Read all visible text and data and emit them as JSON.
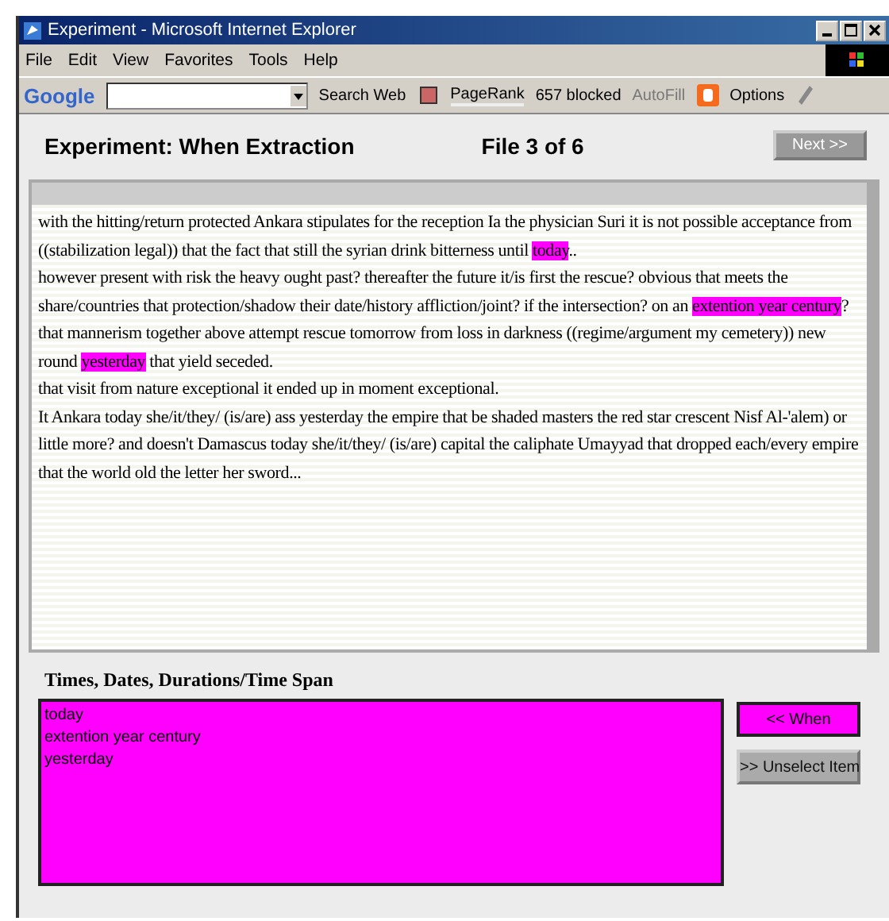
{
  "window": {
    "title": "Experiment - Microsoft Internet Explorer"
  },
  "menu": [
    "File",
    "Edit",
    "View",
    "Favorites",
    "Tools",
    "Help"
  ],
  "toolbar": {
    "logo": "Google",
    "search_button": "Search Web",
    "pagerank": "PageRank",
    "popups": "657 blocked",
    "autofill": {
      "label": "AutoFill",
      "disabled": true
    },
    "options": "Options"
  },
  "header": {
    "title": "Experiment: When Extraction",
    "file": "File 3 of 6",
    "next_button": "Next >>"
  },
  "paragraphs": [
    [
      {
        "text": "with the hitting/return protected Ankara stipulates for the reception Ia the physician Suri it is not possible acceptance from ((stabilization legal)) that the fact that still the syrian drink bitterness until ",
        "highlighted": false
      },
      {
        "text": "today",
        "highlighted": true
      },
      {
        "text": "..",
        "highlighted": false
      }
    ],
    [
      {
        "text": "however present with risk the heavy ought past? thereafter the future it/is first the rescue? obvious that meets the share/countries that protection/shadow their date/history affliction/joint? if the intersection? on an ",
        "highlighted": false
      },
      {
        "text": "extention year century",
        "highlighted": true
      },
      {
        "text": "? that mannerism together above attempt rescue tomorrow from loss in darkness ((regime/argument my cemetery)) new round ",
        "highlighted": false
      },
      {
        "text": "yesterday",
        "highlighted": true
      },
      {
        "text": " that yield seceded.",
        "highlighted": false
      }
    ],
    [
      {
        "text": "that visit from nature exceptional it ended up in moment exceptional.",
        "highlighted": false
      }
    ],
    [
      {
        "text": "It Ankara today she/it/they/ (is/are) ass yesterday the empire that be shaded masters the red star crescent Nisf Al-'alem) or little more? and doesn't Damascus today she/it/they/ (is/are) capital the caliphate Umayyad that dropped each/every empire that the world old the letter her sword...",
        "highlighted": false
      }
    ]
  ],
  "section": {
    "label": "Times, Dates, Durations/Time Span",
    "items": [
      "today",
      "extention year century",
      "yesterday"
    ]
  },
  "buttons": [
    {
      "label": "<< When",
      "kind": "primary"
    },
    {
      "label": ">> Unselect Item",
      "kind": "secondary"
    }
  ]
}
